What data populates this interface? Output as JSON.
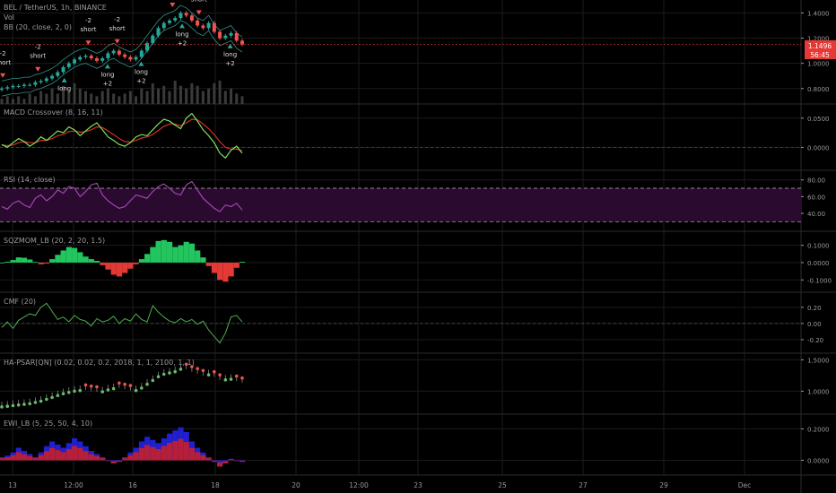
{
  "header": {
    "title": "BEL / TetherUS, 1h, BINANCE",
    "sub1": "Vol",
    "sub2": "BB (20, close, 2, 0)"
  },
  "colors": {
    "bg": "#000000",
    "grid": "#1b1b1b",
    "separator": "#2b2b2b",
    "text": "#9a9a9a",
    "up": "#26a69a",
    "down": "#ef5350",
    "green": "#22c55e",
    "red": "#e53935",
    "macd": "#7ee35a",
    "signal": "#d32f2f",
    "rsi": "#ab47bc",
    "rsiband": "#2a0b2f",
    "cmf": "#4caf50",
    "psar_up": "#66bb6a",
    "psar_down": "#ef5350",
    "ewi_blue": "#2020d0",
    "ewi_red": "#d02020",
    "price_tag": "#e53935"
  },
  "price_badge": {
    "price": "1.1496",
    "countdown": "56:45"
  },
  "x_axis": {
    "labels": [
      "13",
      "12:00",
      "16",
      "18",
      "20",
      "12:00",
      "23",
      "25",
      "27",
      "29",
      "Dec"
    ]
  },
  "chart_data": [
    {
      "panel": "price",
      "type": "candlestick",
      "title": "BEL / TetherUS, 1h, BINANCE",
      "y_ticks": [
        "1.4000",
        "1.2000",
        "1.0000",
        "0.8000"
      ],
      "ylim": [
        0.72,
        1.46
      ],
      "close": [
        0.8,
        0.81,
        0.82,
        0.82,
        0.83,
        0.83,
        0.85,
        0.86,
        0.88,
        0.9,
        0.93,
        0.97,
        1.0,
        1.03,
        1.05,
        1.06,
        1.04,
        1.02,
        1.04,
        1.08,
        1.1,
        1.07,
        1.05,
        1.03,
        1.05,
        1.1,
        1.16,
        1.22,
        1.28,
        1.32,
        1.34,
        1.36,
        1.4,
        1.38,
        1.34,
        1.3,
        1.28,
        1.32,
        1.25,
        1.2,
        1.22,
        1.24,
        1.18,
        1.15
      ],
      "volume": [
        2,
        3,
        2,
        3,
        2,
        4,
        3,
        5,
        4,
        6,
        4,
        7,
        5,
        8,
        6,
        5,
        4,
        3,
        5,
        6,
        4,
        3,
        4,
        5,
        3,
        6,
        5,
        8,
        6,
        7,
        5,
        9,
        7,
        6,
        8,
        7,
        5,
        6,
        8,
        9,
        5,
        6,
        4,
        3
      ],
      "signals": [
        {
          "text": "-2 short",
          "side": "short",
          "pos": 0.004
        },
        {
          "text": "-2 short",
          "side": "short",
          "pos": 0.15
        },
        {
          "text": "-2 short",
          "side": "short",
          "pos": 0.36
        },
        {
          "text": "-2 short",
          "side": "short",
          "pos": 0.48
        },
        {
          "text": "-2 short",
          "side": "short",
          "pos": 0.71
        },
        {
          "text": "-2 short",
          "side": "short",
          "pos": 0.82
        },
        {
          "text": "long",
          "side": "long",
          "pos": 0.26
        },
        {
          "text": "long +2",
          "side": "long",
          "pos": 0.44
        },
        {
          "text": "long +2",
          "side": "long",
          "pos": 0.58
        },
        {
          "text": "long +2",
          "side": "long",
          "pos": 0.75
        },
        {
          "text": "long +2",
          "side": "long",
          "pos": 0.95
        }
      ]
    },
    {
      "panel": "macd",
      "type": "line",
      "title": "MACD Crossover (8, 16, 11)",
      "y_ticks": [
        "0.0500",
        "0.0000"
      ],
      "ylim": [
        -0.03,
        0.065
      ],
      "zero": 0,
      "series": [
        {
          "values": [
            0.005,
            0.0,
            0.008,
            0.015,
            0.01,
            0.002,
            0.008,
            0.018,
            0.012,
            0.02,
            0.028,
            0.025,
            0.035,
            0.03,
            0.02,
            0.028,
            0.036,
            0.042,
            0.03,
            0.018,
            0.012,
            0.005,
            0.002,
            0.008,
            0.018,
            0.022,
            0.02,
            0.03,
            0.04,
            0.048,
            0.045,
            0.038,
            0.032,
            0.05,
            0.058,
            0.045,
            0.03,
            0.02,
            0.008,
            -0.01,
            -0.018,
            -0.005,
            0.002,
            -0.01
          ]
        },
        {
          "values": [
            0.004,
            0.003,
            0.004,
            0.008,
            0.01,
            0.008,
            0.008,
            0.012,
            0.012,
            0.015,
            0.02,
            0.022,
            0.027,
            0.028,
            0.026,
            0.027,
            0.03,
            0.035,
            0.034,
            0.028,
            0.022,
            0.015,
            0.01,
            0.009,
            0.012,
            0.016,
            0.018,
            0.022,
            0.029,
            0.036,
            0.04,
            0.04,
            0.037,
            0.042,
            0.048,
            0.047,
            0.04,
            0.032,
            0.022,
            0.01,
            0.0,
            -0.003,
            -0.003,
            -0.006
          ]
        }
      ]
    },
    {
      "panel": "rsi",
      "type": "line",
      "title": "RSI (14, close)",
      "y_ticks": [
        "80.00",
        "60.00",
        "40.00"
      ],
      "ylim": [
        25,
        85
      ],
      "bands": [
        70,
        30
      ],
      "series": [
        {
          "values": [
            48,
            45,
            52,
            55,
            50,
            47,
            58,
            62,
            55,
            60,
            68,
            64,
            72,
            70,
            60,
            66,
            74,
            76,
            62,
            55,
            50,
            46,
            48,
            55,
            62,
            60,
            58,
            66,
            72,
            75,
            70,
            64,
            62,
            74,
            78,
            68,
            58,
            52,
            46,
            42,
            50,
            48,
            52,
            44
          ]
        }
      ]
    },
    {
      "panel": "sqzmom",
      "type": "bar",
      "title": "SQZMOM_LB (20, 2, 20, 1.5)",
      "y_ticks": [
        "0.1000",
        "0.0000",
        "-0.1000"
      ],
      "ylim": [
        -0.14,
        0.15
      ],
      "values": [
        0.0,
        0.005,
        0.015,
        0.03,
        0.028,
        0.018,
        0.004,
        -0.01,
        -0.006,
        0.02,
        0.045,
        0.07,
        0.09,
        0.085,
        0.06,
        0.035,
        0.02,
        0.01,
        -0.015,
        -0.04,
        -0.07,
        -0.08,
        -0.06,
        -0.035,
        -0.01,
        0.02,
        0.05,
        0.09,
        0.125,
        0.13,
        0.12,
        0.09,
        0.1,
        0.12,
        0.11,
        0.07,
        0.03,
        -0.02,
        -0.06,
        -0.1,
        -0.11,
        -0.08,
        -0.03,
        0.005
      ]
    },
    {
      "panel": "cmf",
      "type": "line",
      "title": "CMF (20)",
      "y_ticks": [
        "0.20",
        "0.00",
        "-0.20"
      ],
      "ylim": [
        -0.3,
        0.32
      ],
      "zero": 0,
      "series": [
        {
          "values": [
            -0.05,
            0.02,
            -0.06,
            0.04,
            0.08,
            0.12,
            0.1,
            0.2,
            0.25,
            0.15,
            0.05,
            0.08,
            0.02,
            0.1,
            0.05,
            0.03,
            -0.03,
            0.06,
            0.02,
            0.04,
            0.09,
            0.0,
            0.06,
            0.03,
            0.12,
            0.05,
            0.02,
            0.22,
            0.14,
            0.08,
            0.03,
            0.01,
            0.06,
            0.02,
            0.05,
            -0.01,
            0.03,
            -0.08,
            -0.16,
            -0.24,
            -0.12,
            0.08,
            0.1,
            0.02
          ]
        }
      ]
    },
    {
      "panel": "psar",
      "type": "line",
      "title": "HA-PSAR[QN] (0.02, 0.02, 0.2, 2018, 1, 1, 2100, 1, 1)",
      "y_ticks": [
        "1.5000",
        "1.0000"
      ],
      "ylim": [
        0.72,
        1.52
      ],
      "series": [
        {
          "values": [
            0.8,
            0.81,
            0.82,
            0.83,
            0.84,
            0.85,
            0.87,
            0.89,
            0.92,
            0.95,
            0.98,
            1.01,
            1.03,
            1.05,
            1.06,
            1.05,
            1.03,
            1.02,
            1.04,
            1.07,
            1.09,
            1.08,
            1.06,
            1.04,
            1.06,
            1.1,
            1.16,
            1.22,
            1.28,
            1.32,
            1.34,
            1.36,
            1.4,
            1.38,
            1.34,
            1.31,
            1.28,
            1.31,
            1.26,
            1.21,
            1.23,
            1.24,
            1.19,
            1.16
          ]
        }
      ]
    },
    {
      "panel": "ewi",
      "type": "bar",
      "title": "EWI_LB (5, 25, 50, 4, 10)",
      "y_ticks": [
        "0.2000",
        "0.0000"
      ],
      "ylim": [
        -0.06,
        0.26
      ],
      "values": [
        0.02,
        0.03,
        0.05,
        0.08,
        0.06,
        0.04,
        0.02,
        0.05,
        0.09,
        0.12,
        0.1,
        0.08,
        0.11,
        0.14,
        0.12,
        0.09,
        0.06,
        0.04,
        0.02,
        0.0,
        -0.02,
        -0.01,
        0.02,
        0.05,
        0.08,
        0.12,
        0.15,
        0.13,
        0.11,
        0.14,
        0.17,
        0.19,
        0.21,
        0.18,
        0.12,
        0.08,
        0.05,
        0.02,
        -0.01,
        -0.04,
        -0.02,
        0.01,
        0.0,
        -0.01
      ]
    }
  ]
}
